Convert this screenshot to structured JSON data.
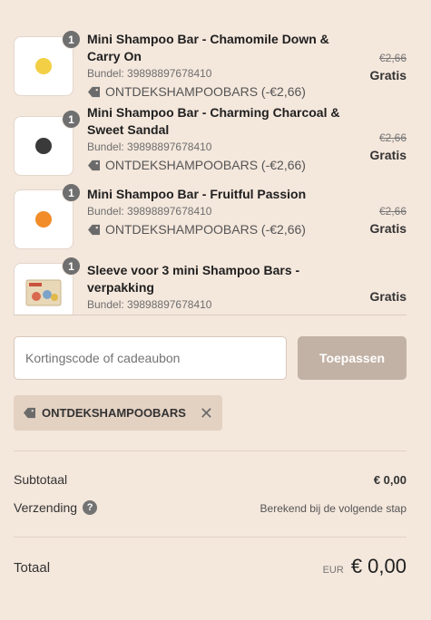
{
  "items": [
    {
      "qty": "1",
      "name": "Mini Shampoo Bar - Chamomile Down & Carry On",
      "bundle": "Bundel: 39898897678410",
      "discount": "ONTDEKSHAMPOOBARS (-€2,66)",
      "old_price": "€2,66",
      "price": "Gratis",
      "color": "#f2cf45"
    },
    {
      "qty": "1",
      "name": "Mini Shampoo Bar - Charming Charcoal & Sweet Sandal",
      "bundle": "Bundel: 39898897678410",
      "discount": "ONTDEKSHAMPOOBARS (-€2,66)",
      "old_price": "€2,66",
      "price": "Gratis",
      "color": "#3a3a3a"
    },
    {
      "qty": "1",
      "name": "Mini Shampoo Bar - Fruitful Passion",
      "bundle": "Bundel: 39898897678410",
      "discount": "ONTDEKSHAMPOOBARS (-€2,66)",
      "old_price": "€2,66",
      "price": "Gratis",
      "color": "#f28c28"
    },
    {
      "qty": "1",
      "name": "Sleeve voor 3 mini Shampoo Bars - verpakking",
      "bundle": "Bundel: 39898897678410",
      "price": "Gratis"
    }
  ],
  "discount_form": {
    "placeholder": "Kortingscode of cadeaubon",
    "apply_label": "Toepassen",
    "applied_code": "ONTDEKSHAMPOOBARS",
    "remove_glyph": "✕"
  },
  "summary": {
    "subtotal_label": "Subtotaal",
    "subtotal_value": "€ 0,00",
    "shipping_label": "Verzending",
    "shipping_help": "?",
    "shipping_value": "Berekend bij de volgende stap",
    "total_label": "Totaal",
    "currency": "EUR",
    "total_value": "€ 0,00"
  }
}
